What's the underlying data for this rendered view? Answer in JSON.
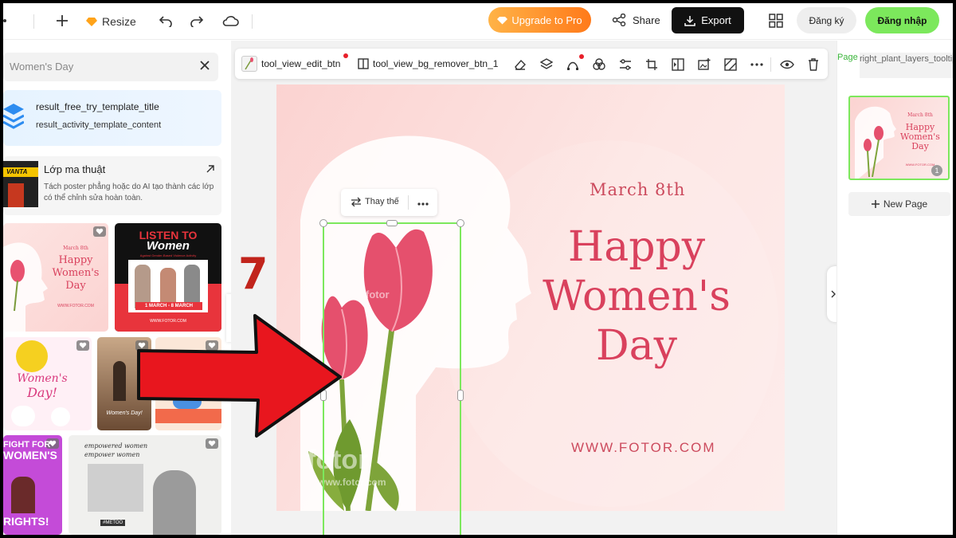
{
  "topbar": {
    "resize_label": "Resize",
    "upgrade_label": "Upgrade to Pro",
    "share_label": "Share",
    "export_label": "Export",
    "signup_label": "Đăng ký",
    "login_label": "Đăng nhập"
  },
  "left_panel": {
    "search_value": "Women's Day",
    "promo": {
      "title": "result_free_try_template_title",
      "content": "result_activity_template_content"
    },
    "magic_layer": {
      "title": "Lớp ma thuật",
      "description": "Tách poster phẳng hoặc do AI tạo thành các lớp có thể chỉnh sửa hoàn toàn.",
      "thumb_text": "VANTA"
    },
    "templates": [
      {
        "lines": [
          "March 8th",
          "Happy",
          "Women's",
          "Day"
        ],
        "footer": "WWW.FOTOR.COM"
      },
      {
        "lines": [
          "LISTEN TO",
          "Women"
        ],
        "sub": "Against Gender-Based Violence Activity",
        "date": "1 MARCH - 8 MARCH",
        "footer": "WWW.FOTOR.COM"
      },
      {
        "lines": [
          "Women's",
          "Day!"
        ]
      },
      {
        "lines": [
          "Women's Day!"
        ]
      },
      {
        "lines": []
      },
      {
        "lines": [
          "FIGHT FOR",
          "WOMEN'S",
          "RIGHTS!"
        ]
      },
      {
        "lines": [
          "empowered women",
          "empower women"
        ],
        "badge": "#METOO"
      }
    ]
  },
  "toolbar": {
    "edit_label": "tool_view_edit_btn",
    "bg_remover_label": "tool_view_bg_remover_btn_1"
  },
  "canvas": {
    "date": "March 8th",
    "line1": "Happy",
    "line2": "Women's",
    "line3": "Day",
    "url": "WWW.FOTOR.COM",
    "watermark": "fotor",
    "watermark_small": "www.fotor.com"
  },
  "float_menu": {
    "replace_label": "Thay thế"
  },
  "annotation_number": "7",
  "right_panel": {
    "page_tab": "Page",
    "layers_tab": "right_plant_layers_tooltip",
    "page_number": "1",
    "new_page_label": "New Page",
    "thumb": {
      "date": "March 8th",
      "l1": "Happy",
      "l2": "Women's",
      "l3": "Day",
      "footer": "WWW.FOTOR.COM"
    }
  },
  "colors": {
    "accent_green": "#7ce85c",
    "canvas_pink": "#fbd3d1",
    "title_red": "#d9415d",
    "arrow_red": "#e8161e"
  }
}
